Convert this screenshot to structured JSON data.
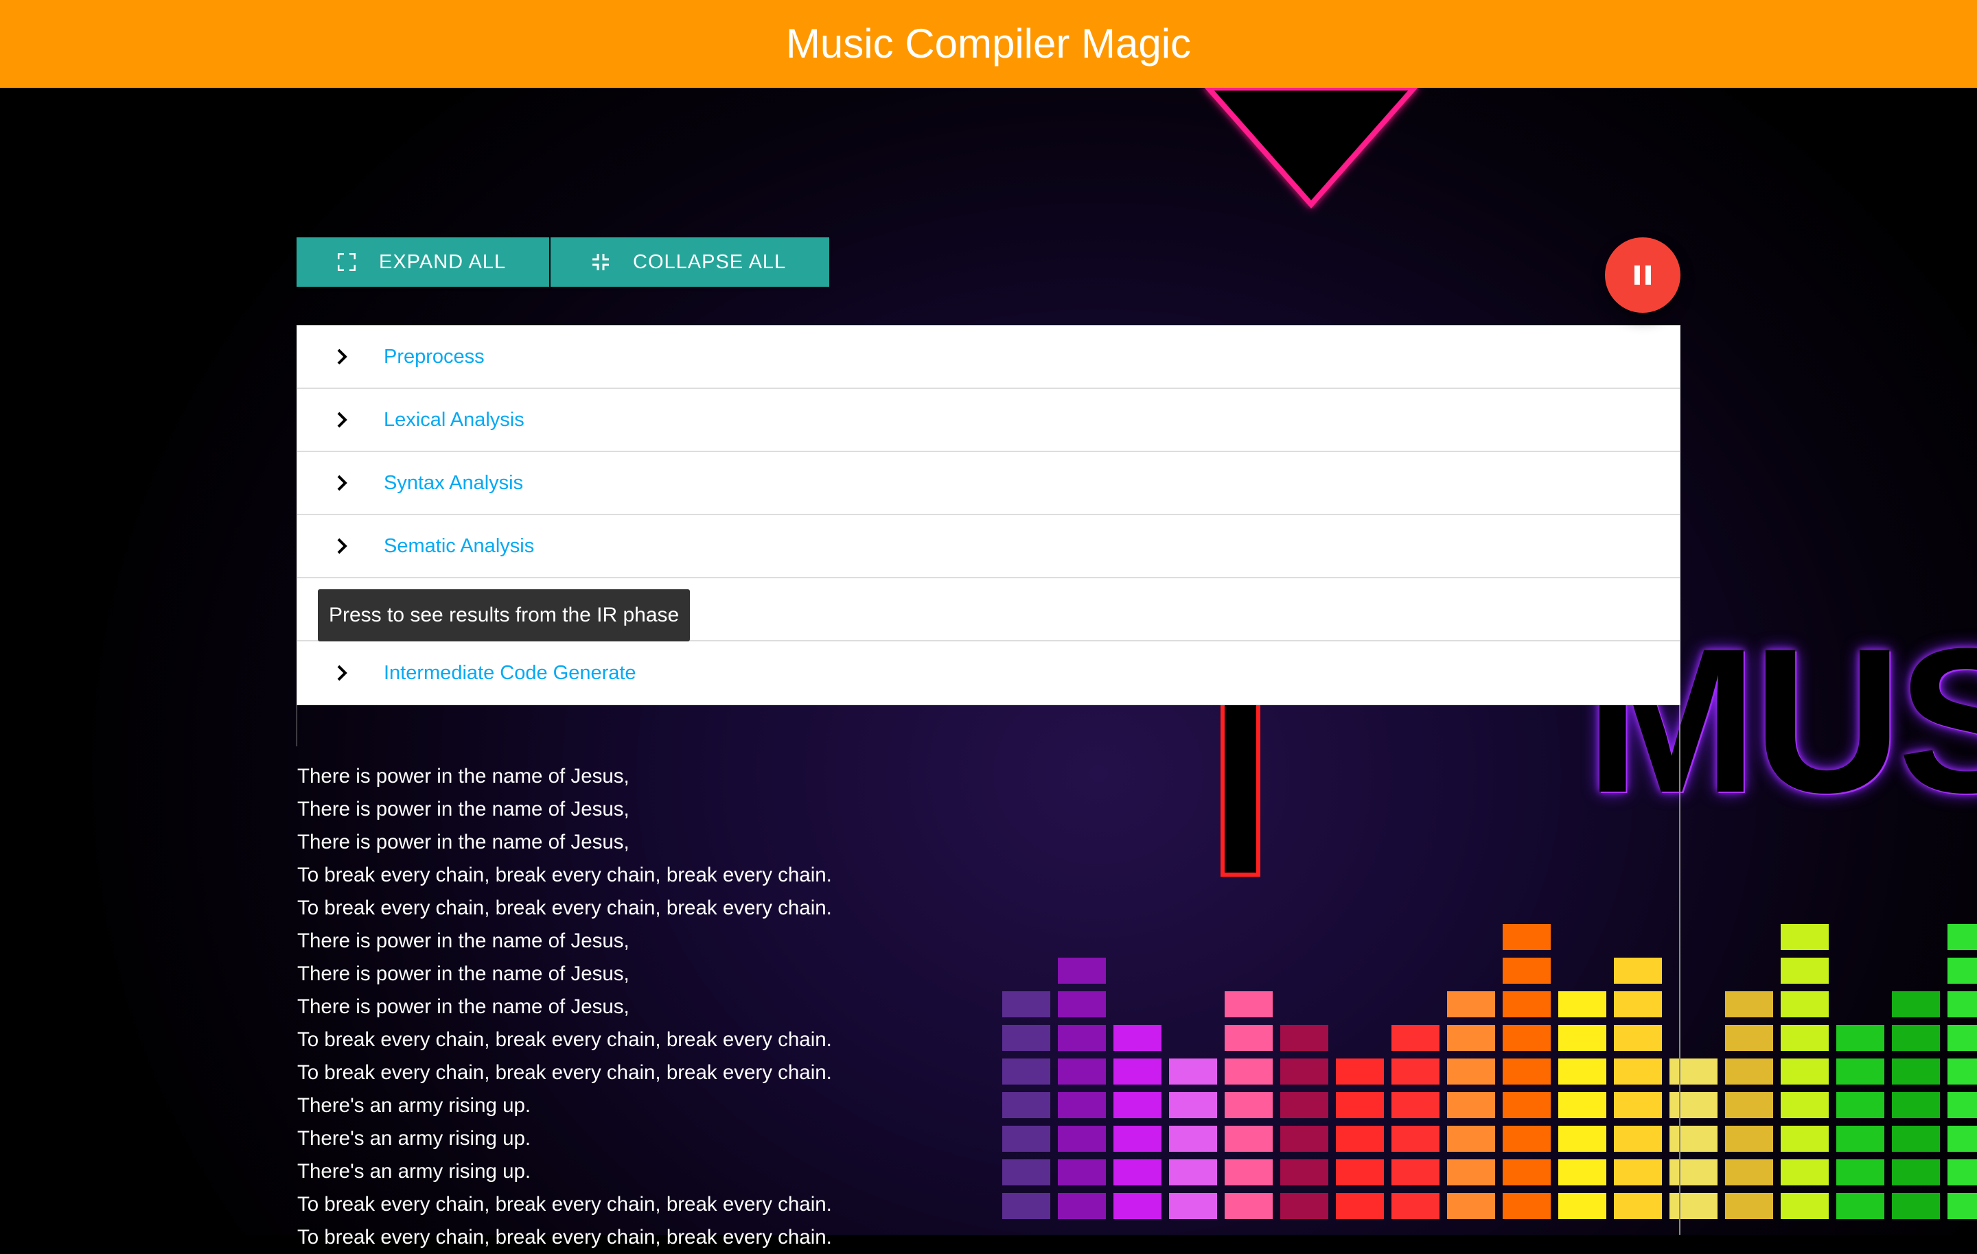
{
  "app": {
    "title": "Music Compiler Magic"
  },
  "toolbar": {
    "expand_label": "EXPAND ALL",
    "collapse_label": "COLLAPSE ALL",
    "play_state": "pause-icon"
  },
  "accordion": {
    "items": [
      {
        "label": "Preprocess"
      },
      {
        "label": "Lexical Analysis"
      },
      {
        "label": "Syntax Analysis"
      },
      {
        "label": "Sematic Analysis"
      },
      {
        "label": ""
      },
      {
        "label": "Intermediate Code Generate"
      }
    ]
  },
  "tooltip": {
    "text": "Press to see results from the IR phase"
  },
  "background": {
    "text": "MUS",
    "icon": "heart-icon"
  },
  "lyrics": [
    "There is power in the name of Jesus,",
    "There is power in the name of Jesus,",
    "There is power in the name of Jesus,",
    "To break every chain, break every chain, break every chain.",
    "To break every chain, break every chain, break every chain.",
    "There is power in the name of Jesus,",
    "There is power in the name of Jesus,",
    "There is power in the name of Jesus,",
    "To break every chain, break every chain, break every chain.",
    "To break every chain, break every chain, break every chain.",
    "There's an army rising up.",
    "There's an army rising up.",
    "There's an army rising up.",
    "To break every chain, break every chain, break every chain.",
    "To break every chain, break every chain, break every chain."
  ],
  "colors": {
    "topbar": "#ff9800",
    "button": "#26a69a",
    "fab": "#f44336",
    "link": "#03a9f4",
    "tooltip": "#323232"
  }
}
